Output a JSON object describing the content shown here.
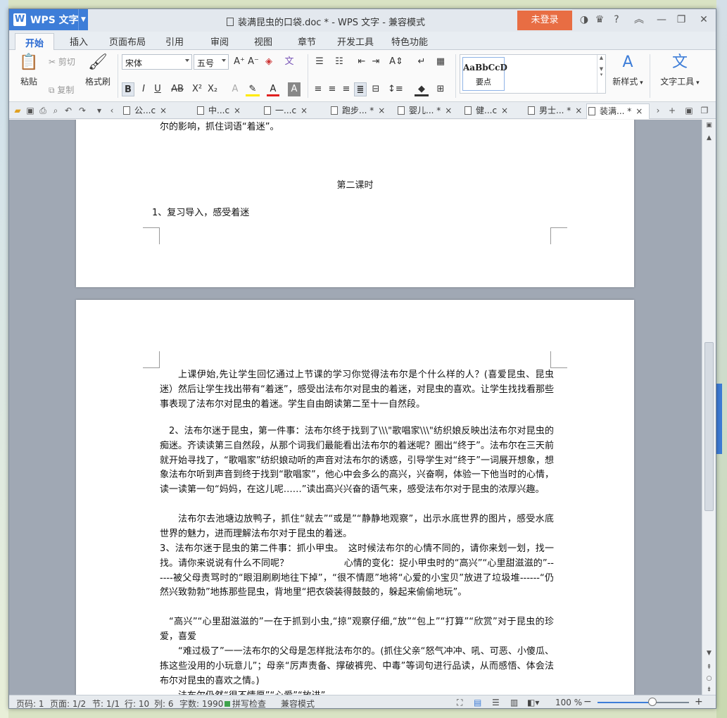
{
  "titlebar": {
    "app_name": "WPS 文字",
    "doc_title": "装满昆虫的口袋.doc * - WPS 文字 - 兼容模式",
    "login": "未登录"
  },
  "menu": {
    "tabs": [
      "开始",
      "插入",
      "页面布局",
      "引用",
      "审阅",
      "视图",
      "章节",
      "开发工具",
      "特色功能"
    ]
  },
  "ribbon": {
    "paste": "粘贴",
    "cut": "剪切",
    "copy": "复制",
    "format_painter": "格式刷",
    "font_name": "宋体",
    "font_size": "五号",
    "style_sample": "AaBbCcD",
    "style_name": "要点",
    "new_style": "新样式",
    "text_tools": "文字工具"
  },
  "tabs": {
    "docs": [
      {
        "label": "公...c",
        "close": "×"
      },
      {
        "label": "中...c",
        "close": "×"
      },
      {
        "label": "一...c",
        "close": "×"
      },
      {
        "label": "跑步... *",
        "close": "×"
      },
      {
        "label": "婴儿... *",
        "close": "×"
      },
      {
        "label": "健...c",
        "close": "×"
      },
      {
        "label": "男士... *",
        "close": "×"
      },
      {
        "label": "装满... *",
        "close": "×"
      }
    ]
  },
  "document": {
    "page1_top": "溪纵横”“花草丛生”“鸟栖虫居”所描绘的美丽景色，通过这些语言感知从小生活的环境对法布尔的影响，抓住词语“着迷”。",
    "page1_heading": "第二课时",
    "page1_item": "1、复习导入，感受着迷",
    "p1": "上课伊始,先让学生回忆通过上节课的学习你觉得法布尔是个什么样的人？(喜爱昆虫、昆虫迷）然后让学生找出带有“着迷”，感受出法布尔对昆虫的着迷，对昆虫的喜欢。让学生找找看那些事表现了法布尔对昆虫的着迷。学生自由朗读第二至十一自然段。",
    "p2": "2、法布尔迷于昆虫，第一件事：法布尔终于找到了\\\\\\\"歌唱家\\\\\\\"纺织娘反映出法布尔对昆虫的痴迷。齐读读第三自然段，从那个词我们最能看出法布尔的着迷呢？圈出“终于”。法布尔在三天前就开始寻找了，“歌唱家”纺织娘动听的声音对法布尔的诱惑，引导学生对“终于”一词展开想象，想象法布尔听到声音到终于找到“歌唱家”，他心中会多么的高兴，兴奋啊，体验一下他当时的心情，读一读第一句“妈妈，在这儿呢……”读出高兴兴奋的语气来，感受法布尔对于昆虫的浓厚兴趣。",
    "p3": "法布尔去池塘边放鸭子，抓住“就去”“或是”“静静地观察”，出示水底世界的图片，感受水底世界的魅力，进而理解法布尔对于昆虫的着迷。",
    "p4": "3、法布尔迷于昆虫的第二件事：抓小甲虫。　这时候法布尔的心情不同的，请你来划一划，找一找。请你来说说有什么不同呢？　　　　　　心情的变化：捉小甲虫时的“高兴”“心里甜滋滋的”------被父母责骂时的“眼泪刷刷地往下掉”，“很不情愿”地将“心爱的小宝贝”放进了垃圾堆------“仍然兴致勃勃”地拣那些昆虫，背地里“把衣袋装得鼓鼓的，躲起来偷偷地玩”。",
    "p5": "“高兴”“心里甜滋滋的”一在于抓到小虫,“掠”观察仔细,“放”“包上”“打算”“欣赏”对于昆虫的珍爱，喜爱",
    "p6": "“难过极了”一一法布尔的父母是怎样批法布尔的。(抓住父亲“怒气冲冲、吼、可恶、小傻瓜、拣这些没用的小玩意儿”；母亲“厉声责备、撑破裤兜、中毒”等词句进行品读，从而感悟、体会法布尔对昆虫的喜欢之情。)",
    "p7_partial": "法布尔仍然“很不情愿”“心爱”“放进”"
  },
  "statusbar": {
    "page_num": "页码: 1",
    "pages": "页面: 1/2",
    "section": "节: 1/1",
    "row": "行: 10",
    "col": "列: 6",
    "words": "字数: 1990",
    "spell": "拼写检查",
    "mode": "兼容模式",
    "zoom": "100 %",
    "zoom_level": 0.6
  },
  "colors": {
    "accent": "#3d7dd8",
    "login": "#e86d43"
  }
}
